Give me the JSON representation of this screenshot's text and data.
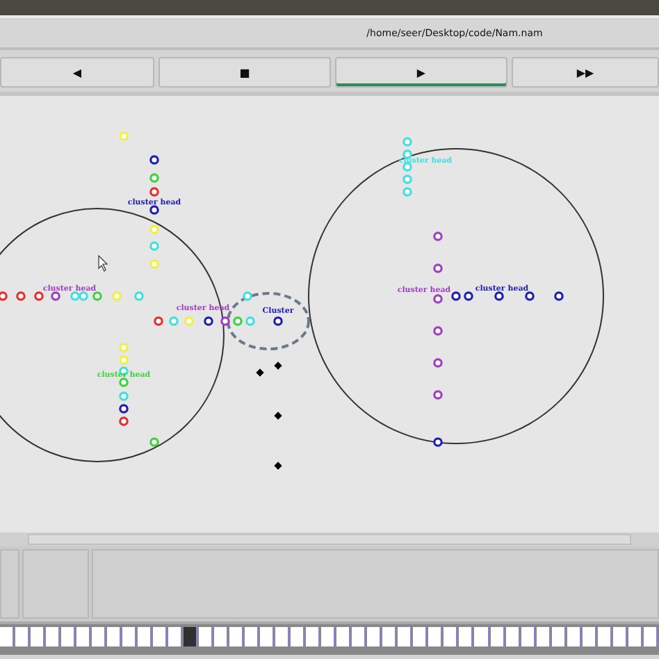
{
  "window": {
    "title": "/home/seer/Desktop/code/Nam.nam"
  },
  "controls": [
    {
      "label": "◀",
      "selected": false
    },
    {
      "label": "■",
      "selected": false
    },
    {
      "label": "▶",
      "selected": true
    },
    {
      "label": "▶▶",
      "selected": false
    }
  ],
  "canvas": {
    "nodes": [
      {
        "color": "#f0f040"
      },
      {
        "color": "#2020b0"
      },
      {
        "color": "#40d040"
      },
      {
        "color": "#e03030"
      },
      {
        "color": "#2020b0"
      },
      {
        "color": "#f0f040"
      },
      {
        "color": "#40e0e0"
      },
      {
        "color": "#f0f040"
      },
      {
        "color": "#e03030"
      },
      {
        "color": "#e03030"
      },
      {
        "color": "#e03030"
      },
      {
        "color": "#a040c0"
      },
      {
        "color": "#40e0e0"
      },
      {
        "color": "#40e0e0"
      },
      {
        "color": "#40d040"
      },
      {
        "color": "#f0f040"
      },
      {
        "color": "#40e0e0"
      },
      {
        "color": "#e03030"
      },
      {
        "color": "#40e0e0"
      },
      {
        "color": "#f0f040"
      },
      {
        "color": "#2020b0"
      },
      {
        "color": "#a040c0"
      },
      {
        "color": "#40d040"
      },
      {
        "color": "#40e0e0"
      },
      {
        "color": "#2020b0"
      },
      {
        "color": "#40e0e0"
      },
      {
        "color": "#f0f040"
      },
      {
        "color": "#f0f040"
      },
      {
        "color": "#40e0e0"
      },
      {
        "color": "#40d040"
      },
      {
        "color": "#40e0e0"
      },
      {
        "color": "#2020b0"
      },
      {
        "color": "#e03030"
      },
      {
        "color": "#40d040"
      },
      {
        "color": "#40e0e0"
      },
      {
        "color": "#40e0e0"
      },
      {
        "color": "#40e0e0"
      },
      {
        "color": "#40e0e0"
      },
      {
        "color": "#40e0e0"
      },
      {
        "color": "#a040c0"
      },
      {
        "color": "#a040c0"
      },
      {
        "color": "#a040c0"
      },
      {
        "color": "#a040c0"
      },
      {
        "color": "#a040c0"
      },
      {
        "color": "#a040c0"
      },
      {
        "color": "#2020b0"
      },
      {
        "color": "#2020b0"
      },
      {
        "color": "#2020b0"
      },
      {
        "color": "#2020b0"
      },
      {
        "color": "#2020b0"
      },
      {
        "color": "#2020b0"
      }
    ],
    "labels": [
      {
        "text": "cluster head",
        "color": "#2020b0"
      },
      {
        "text": "cluster head",
        "color": "#a040c0"
      },
      {
        "text": "cluster head",
        "color": "#a040c0"
      },
      {
        "text": "Cluster",
        "color": "#2020b0"
      },
      {
        "text": "cluster head",
        "color": "#40d040"
      },
      {
        "text": "cluster head",
        "color": "#40e0e0"
      },
      {
        "text": "cluster head",
        "color": "#a040c0"
      },
      {
        "text": "cluster head",
        "color": "#2020b0"
      }
    ]
  }
}
